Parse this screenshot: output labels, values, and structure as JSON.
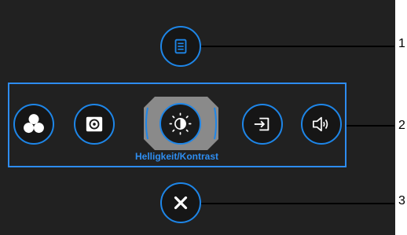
{
  "osd": {
    "menu_button": {
      "icon": "menu-icon"
    },
    "function_buttons": [
      {
        "icon": "color-preset-icon",
        "selected": false
      },
      {
        "icon": "input-source-picture-icon",
        "selected": false
      },
      {
        "icon": "brightness-contrast-icon",
        "selected": true
      },
      {
        "icon": "input-source-icon",
        "selected": false
      },
      {
        "icon": "volume-icon",
        "selected": false
      }
    ],
    "selected_label": "Helligkeit/Kontrast",
    "exit_button": {
      "icon": "close-icon"
    }
  },
  "callouts": [
    "1",
    "2",
    "3"
  ],
  "colors": {
    "accent": "#1e86e8",
    "panel": "#212121",
    "label": "#2e8ef2"
  }
}
